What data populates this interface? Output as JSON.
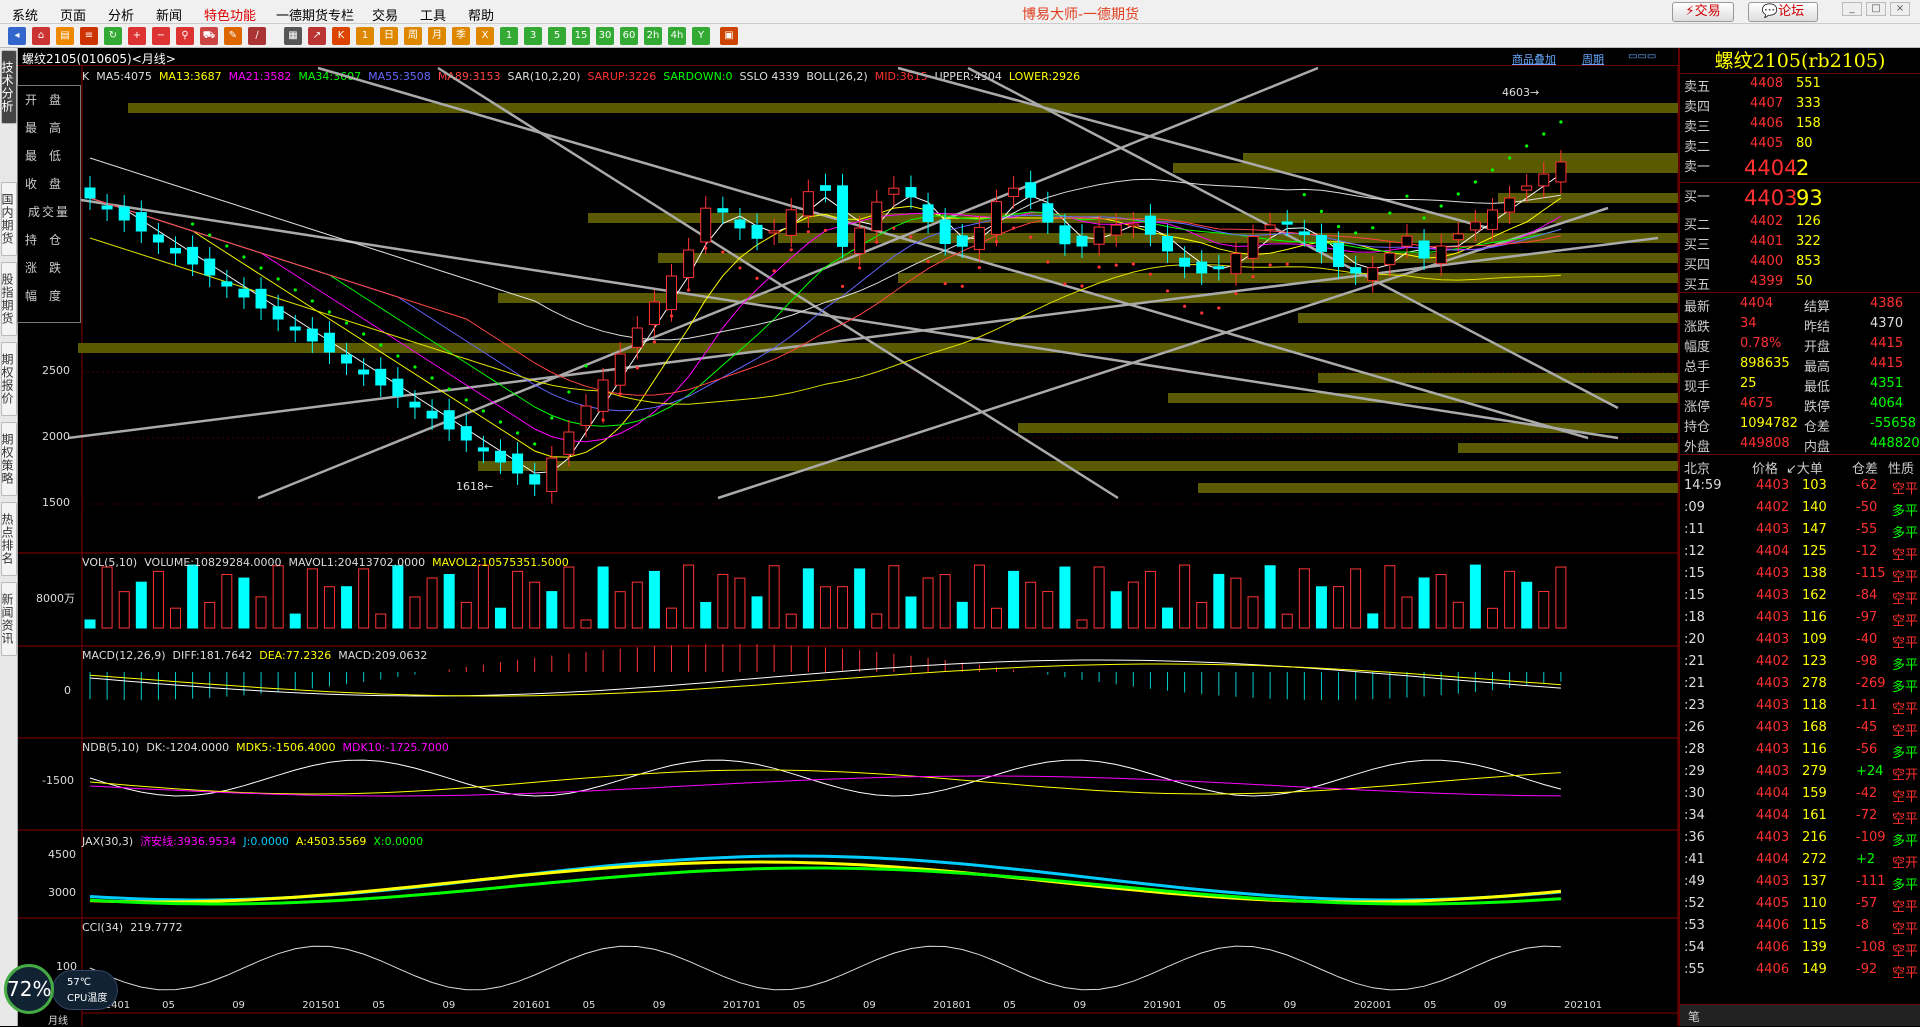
{
  "menu": {
    "items": [
      "系统",
      "页面",
      "分析",
      "新闻",
      "特色功能",
      "一德期货专栏",
      "交易",
      "工具",
      "帮助"
    ],
    "app_title": "博易大师-一德期货",
    "trade_btn": "交易",
    "forum_btn": "论坛"
  },
  "lefttabs": [
    "技术分析",
    "国内期货",
    "股指期货",
    "期权报价",
    "期权策略",
    "热点排名",
    "新闻资讯"
  ],
  "chart": {
    "title": "螺纹2105(010605)<月线>",
    "links": [
      "商品叠加",
      "周期"
    ],
    "main_ind": {
      "k": "K",
      "ma5": "MA5:4075",
      "ma13": "MA13:3687",
      "ma21": "MA21:3582",
      "ma34": "MA34:3607",
      "ma55": "MA55:3508",
      "ma89": "MA89:3153",
      "sar": "SAR(10,2,20)",
      "sarup": "SARUP:3226",
      "sardown": "SARDOWN:0",
      "sslo": "SSLO 4339",
      "boll": "BOLL(26,2)",
      "mid": "MID:3615",
      "upper": "UPPER:4304",
      "lower": "LOWER:2926"
    },
    "high_mark": "4603→",
    "low_mark": "1618←",
    "yaxis": [
      "2500",
      "2000",
      "1500"
    ],
    "vol": {
      "title": "VOL(5,10)",
      "volume": "VOLUME:10829284.0000",
      "mavol1": "MAVOL1:20413702.0000",
      "mavol2": "MAVOL2:10575351.5000",
      "y": "8000万"
    },
    "macd": {
      "title": "MACD(12,26,9)",
      "diff": "DIFF:181.7642",
      "dea": "DEA:77.2326",
      "macd": "MACD:209.0632",
      "y": "0"
    },
    "ndb": {
      "title": "NDB(5,10)",
      "dk": "DK:-1204.0000",
      "mdk5": "MDK5:-1506.4000",
      "mdk10": "MDK10:-1725.7000",
      "y": "-1500"
    },
    "jax": {
      "title": "JAX(30,3)",
      "line": "济安线:3936.9534",
      "j": "J:0.0000",
      "a": "A:4503.5569",
      "x": "X:0.0000",
      "y1": "4500",
      "y2": "3000"
    },
    "cci": {
      "title": "CCI(34)",
      "val": "219.7772",
      "y": "100"
    },
    "xaxis": [
      "201401",
      "05",
      "09",
      "201501",
      "05",
      "09",
      "201601",
      "05",
      "09",
      "201701",
      "05",
      "09",
      "201801",
      "05",
      "09",
      "201901",
      "05",
      "09",
      "202001",
      "05",
      "09",
      "202101"
    ],
    "xaxis_label": "月线"
  },
  "sidebox": [
    "开盘",
    "最高",
    "最低",
    "收盘",
    "成交量",
    "持仓",
    "涨跌",
    "幅度"
  ],
  "quote": {
    "title": "螺纹2105(rb2105)",
    "asks": [
      [
        "卖五",
        "4408",
        "551"
      ],
      [
        "卖四",
        "4407",
        "333"
      ],
      [
        "卖三",
        "4406",
        "158"
      ],
      [
        "卖二",
        "4405",
        "80"
      ]
    ],
    "ask1": [
      "卖一",
      "4404",
      "2"
    ],
    "bid1": [
      "买一",
      "4403",
      "93"
    ],
    "bids": [
      [
        "买二",
        "4402",
        "126"
      ],
      [
        "买三",
        "4401",
        "322"
      ],
      [
        "买四",
        "4400",
        "853"
      ],
      [
        "买五",
        "4399",
        "50"
      ]
    ],
    "stats": [
      [
        "最新",
        "4404",
        "结算",
        "4386"
      ],
      [
        "涨跌",
        "34",
        "昨结",
        "4370"
      ],
      [
        "幅度",
        "0.78%",
        "开盘",
        "4415"
      ],
      [
        "总手",
        "898635",
        "最高",
        "4415"
      ],
      [
        "现手",
        "25",
        "最低",
        "4351"
      ],
      [
        "涨停",
        "4675",
        "跌停",
        "4064"
      ],
      [
        "持仓",
        "1094782",
        "仓差",
        "-55658"
      ],
      [
        "外盘",
        "449808",
        "内盘",
        "448820"
      ]
    ],
    "tick_header": [
      "北京",
      "价格",
      "↙大单",
      "仓差",
      "性质"
    ],
    "ticks": [
      [
        "14:59",
        "4403",
        "103",
        "-62",
        "空平"
      ],
      [
        ":09",
        "4402",
        "140",
        "-50",
        "多平"
      ],
      [
        ":11",
        "4403",
        "147",
        "-55",
        "多平"
      ],
      [
        ":12",
        "4404",
        "125",
        "-12",
        "空平"
      ],
      [
        ":15",
        "4403",
        "138",
        "-115",
        "空平"
      ],
      [
        ":15",
        "4403",
        "162",
        "-84",
        "空平"
      ],
      [
        ":18",
        "4403",
        "116",
        "-97",
        "空平"
      ],
      [
        ":20",
        "4403",
        "109",
        "-40",
        "空平"
      ],
      [
        ":21",
        "4402",
        "123",
        "-98",
        "多平"
      ],
      [
        ":21",
        "4403",
        "278",
        "-269",
        "多平"
      ],
      [
        ":23",
        "4403",
        "118",
        "-11",
        "空平"
      ],
      [
        ":26",
        "4403",
        "168",
        "-45",
        "空平"
      ],
      [
        ":28",
        "4403",
        "116",
        "-56",
        "多平"
      ],
      [
        ":29",
        "4403",
        "279",
        "+24",
        "空开"
      ],
      [
        ":30",
        "4404",
        "159",
        "-42",
        "空平"
      ],
      [
        ":34",
        "4404",
        "161",
        "-72",
        "空平"
      ],
      [
        ":36",
        "4403",
        "216",
        "-109",
        "多平"
      ],
      [
        ":41",
        "4404",
        "272",
        "+2",
        "空开"
      ],
      [
        ":49",
        "4403",
        "137",
        "-111",
        "多平"
      ],
      [
        ":52",
        "4405",
        "110",
        "-57",
        "空平"
      ],
      [
        ":53",
        "4406",
        "115",
        "-8",
        "空平"
      ],
      [
        ":54",
        "4406",
        "139",
        "-108",
        "空平"
      ],
      [
        ":55",
        "4406",
        "149",
        "-92",
        "空平"
      ]
    ],
    "status": "笔"
  },
  "cpu": {
    "pct": "72%",
    "temp": "57℃",
    "label": "CPU温度"
  }
}
